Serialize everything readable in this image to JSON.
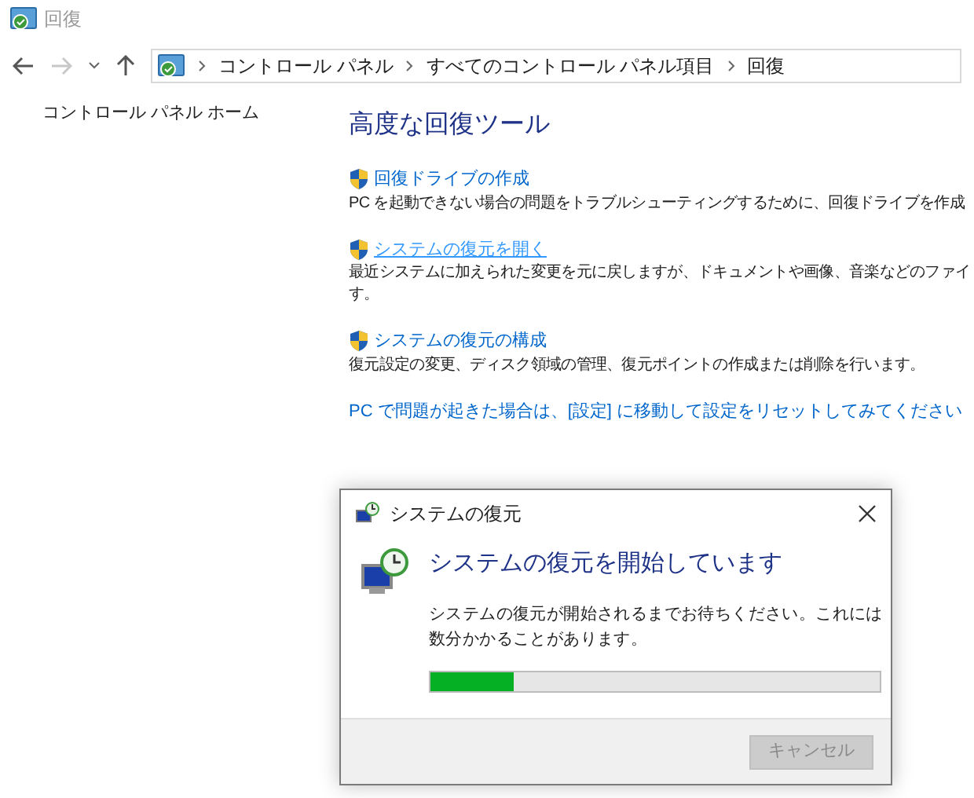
{
  "window": {
    "title": "回復"
  },
  "address_bar": {
    "crumbs": [
      "コントロール パネル",
      "すべてのコントロール パネル項目",
      "回復"
    ]
  },
  "sidebar": {
    "items": [
      "コントロール パネル ホーム"
    ]
  },
  "main": {
    "heading": "高度な回復ツール",
    "tools": [
      {
        "link": "回復ドライブの作成",
        "hovered": false,
        "lines": [
          "PC を起動できない場合の問題をトラブルシューティングするために、回復ドライブを作成"
        ]
      },
      {
        "link": "システムの復元を開く",
        "hovered": true,
        "lines": [
          "最近システムに加えられた変更を元に戻しますが、ドキュメントや画像、音楽などのファイ",
          "す。"
        ]
      },
      {
        "link": "システムの復元の構成",
        "hovered": false,
        "lines": [
          "復元設定の変更、ディスク領域の管理、復元ポイントの作成または削除を行います。"
        ]
      }
    ],
    "reset_link": "PC で問題が起きた場合は、[設定] に移動して設定をリセットしてみてください"
  },
  "dialog": {
    "title": "システムの復元",
    "heading": "システムの復元を開始しています",
    "message": "システムの復元が開始されるまでお待ちください。これには数分かかることがあります。",
    "progress": {
      "level": 0.185
    },
    "buttons": [
      {
        "label": "キャンセル",
        "disabled": true
      }
    ]
  }
}
